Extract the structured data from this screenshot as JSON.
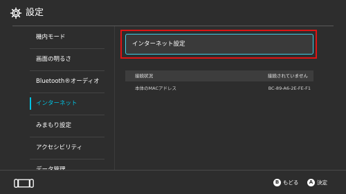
{
  "header": {
    "title": "設定",
    "icon": "gear-icon"
  },
  "sidebar": {
    "selected_index": 3,
    "accent_color": "#00c3e3",
    "items": [
      {
        "label": "機内モード"
      },
      {
        "label": "画面の明るさ"
      },
      {
        "label": "Bluetooth®オーディオ"
      },
      {
        "label": "インターネット"
      },
      {
        "label": "みまもり設定"
      },
      {
        "label": "アクセシビリティ"
      },
      {
        "label": "データ管理"
      }
    ]
  },
  "main": {
    "internet_settings_button": "インターネット設定",
    "highlight_color": "#e01414",
    "info": {
      "header_key": "接続状況",
      "header_value": "接続されていません",
      "rows": [
        {
          "key": "本体のMACアドレス",
          "value": "BC-89-A6-2E-FE-F1"
        }
      ]
    }
  },
  "footer": {
    "console_icon": "console-icon",
    "back_button_glyph": "B",
    "back_label": "もどる",
    "ok_button_glyph": "A",
    "ok_label": "決定"
  }
}
